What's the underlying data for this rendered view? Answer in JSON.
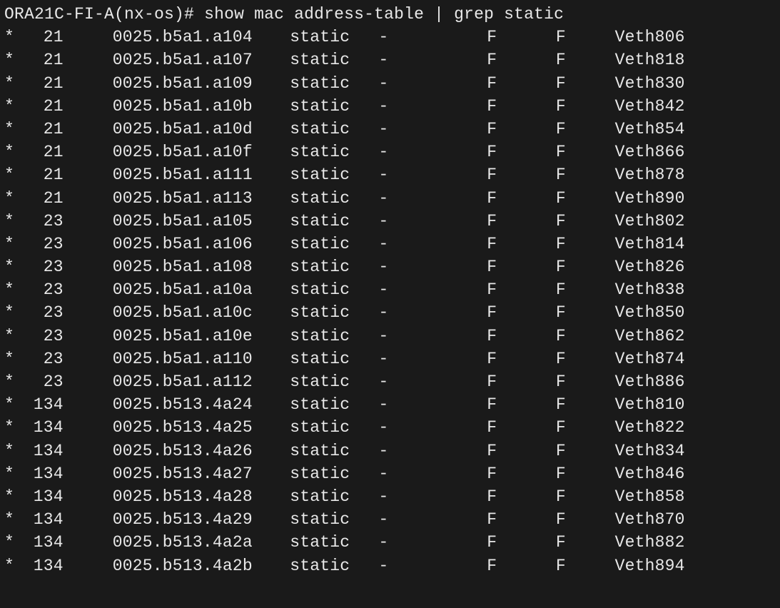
{
  "prompt": {
    "host": "ORA21C-FI-A(nx-os)#",
    "command": "show mac address-table | grep static"
  },
  "rows": [
    {
      "flag": "*",
      "vlan": "21",
      "mac": "0025.b5a1.a104",
      "type": "static",
      "age": "-",
      "secure": "F",
      "ntfy": "F",
      "port": "Veth806"
    },
    {
      "flag": "*",
      "vlan": "21",
      "mac": "0025.b5a1.a107",
      "type": "static",
      "age": "-",
      "secure": "F",
      "ntfy": "F",
      "port": "Veth818"
    },
    {
      "flag": "*",
      "vlan": "21",
      "mac": "0025.b5a1.a109",
      "type": "static",
      "age": "-",
      "secure": "F",
      "ntfy": "F",
      "port": "Veth830"
    },
    {
      "flag": "*",
      "vlan": "21",
      "mac": "0025.b5a1.a10b",
      "type": "static",
      "age": "-",
      "secure": "F",
      "ntfy": "F",
      "port": "Veth842"
    },
    {
      "flag": "*",
      "vlan": "21",
      "mac": "0025.b5a1.a10d",
      "type": "static",
      "age": "-",
      "secure": "F",
      "ntfy": "F",
      "port": "Veth854"
    },
    {
      "flag": "*",
      "vlan": "21",
      "mac": "0025.b5a1.a10f",
      "type": "static",
      "age": "-",
      "secure": "F",
      "ntfy": "F",
      "port": "Veth866"
    },
    {
      "flag": "*",
      "vlan": "21",
      "mac": "0025.b5a1.a111",
      "type": "static",
      "age": "-",
      "secure": "F",
      "ntfy": "F",
      "port": "Veth878"
    },
    {
      "flag": "*",
      "vlan": "21",
      "mac": "0025.b5a1.a113",
      "type": "static",
      "age": "-",
      "secure": "F",
      "ntfy": "F",
      "port": "Veth890"
    },
    {
      "flag": "*",
      "vlan": "23",
      "mac": "0025.b5a1.a105",
      "type": "static",
      "age": "-",
      "secure": "F",
      "ntfy": "F",
      "port": "Veth802"
    },
    {
      "flag": "*",
      "vlan": "23",
      "mac": "0025.b5a1.a106",
      "type": "static",
      "age": "-",
      "secure": "F",
      "ntfy": "F",
      "port": "Veth814"
    },
    {
      "flag": "*",
      "vlan": "23",
      "mac": "0025.b5a1.a108",
      "type": "static",
      "age": "-",
      "secure": "F",
      "ntfy": "F",
      "port": "Veth826"
    },
    {
      "flag": "*",
      "vlan": "23",
      "mac": "0025.b5a1.a10a",
      "type": "static",
      "age": "-",
      "secure": "F",
      "ntfy": "F",
      "port": "Veth838"
    },
    {
      "flag": "*",
      "vlan": "23",
      "mac": "0025.b5a1.a10c",
      "type": "static",
      "age": "-",
      "secure": "F",
      "ntfy": "F",
      "port": "Veth850"
    },
    {
      "flag": "*",
      "vlan": "23",
      "mac": "0025.b5a1.a10e",
      "type": "static",
      "age": "-",
      "secure": "F",
      "ntfy": "F",
      "port": "Veth862"
    },
    {
      "flag": "*",
      "vlan": "23",
      "mac": "0025.b5a1.a110",
      "type": "static",
      "age": "-",
      "secure": "F",
      "ntfy": "F",
      "port": "Veth874"
    },
    {
      "flag": "*",
      "vlan": "23",
      "mac": "0025.b5a1.a112",
      "type": "static",
      "age": "-",
      "secure": "F",
      "ntfy": "F",
      "port": "Veth886"
    },
    {
      "flag": "*",
      "vlan": "134",
      "mac": "0025.b513.4a24",
      "type": "static",
      "age": "-",
      "secure": "F",
      "ntfy": "F",
      "port": "Veth810"
    },
    {
      "flag": "*",
      "vlan": "134",
      "mac": "0025.b513.4a25",
      "type": "static",
      "age": "-",
      "secure": "F",
      "ntfy": "F",
      "port": "Veth822"
    },
    {
      "flag": "*",
      "vlan": "134",
      "mac": "0025.b513.4a26",
      "type": "static",
      "age": "-",
      "secure": "F",
      "ntfy": "F",
      "port": "Veth834"
    },
    {
      "flag": "*",
      "vlan": "134",
      "mac": "0025.b513.4a27",
      "type": "static",
      "age": "-",
      "secure": "F",
      "ntfy": "F",
      "port": "Veth846"
    },
    {
      "flag": "*",
      "vlan": "134",
      "mac": "0025.b513.4a28",
      "type": "static",
      "age": "-",
      "secure": "F",
      "ntfy": "F",
      "port": "Veth858"
    },
    {
      "flag": "*",
      "vlan": "134",
      "mac": "0025.b513.4a29",
      "type": "static",
      "age": "-",
      "secure": "F",
      "ntfy": "F",
      "port": "Veth870"
    },
    {
      "flag": "*",
      "vlan": "134",
      "mac": "0025.b513.4a2a",
      "type": "static",
      "age": "-",
      "secure": "F",
      "ntfy": "F",
      "port": "Veth882"
    },
    {
      "flag": "*",
      "vlan": "134",
      "mac": "0025.b513.4a2b",
      "type": "static",
      "age": "-",
      "secure": "F",
      "ntfy": "F",
      "port": "Veth894"
    }
  ]
}
